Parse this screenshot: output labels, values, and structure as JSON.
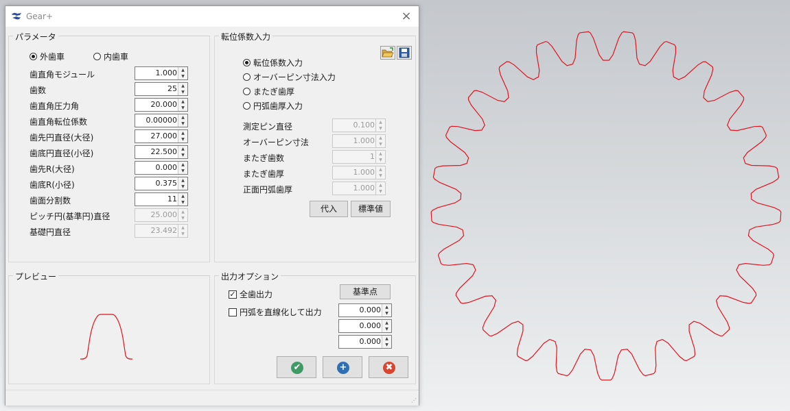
{
  "window": {
    "title": "Gear+",
    "close_glyph": "×"
  },
  "params": {
    "group_label": "パラメータ",
    "external_gear": "外歯車",
    "internal_gear": "内歯車",
    "rows": [
      {
        "label": "歯直角モジュール",
        "value": "1.000",
        "enabled": true
      },
      {
        "label": "歯数",
        "value": "25",
        "enabled": true
      },
      {
        "label": "歯直角圧力角",
        "value": "20.000",
        "enabled": true
      },
      {
        "label": "歯直角転位係数",
        "value": "0.00000",
        "enabled": true
      },
      {
        "label": "歯先円直径(大径)",
        "value": "27.000",
        "enabled": true
      },
      {
        "label": "歯底円直径(小径)",
        "value": "22.500",
        "enabled": true
      },
      {
        "label": "歯先R(大径)",
        "value": "0.000",
        "enabled": true
      },
      {
        "label": "歯底R(小径)",
        "value": "0.375",
        "enabled": true
      },
      {
        "label": "歯面分割数",
        "value": "11",
        "enabled": true
      },
      {
        "label": "ピッチ円(基準円)直径",
        "value": "25.000",
        "enabled": false
      },
      {
        "label": "基礎円直径",
        "value": "23.492",
        "enabled": false
      }
    ]
  },
  "shift": {
    "group_label": "転位係数入力",
    "options": [
      "転位係数入力",
      "オーバーピン寸法入力",
      "またぎ歯厚",
      "円弧歯厚入力"
    ],
    "selected_index": 0,
    "rows": [
      {
        "label": "測定ピン直径",
        "value": "0.100"
      },
      {
        "label": "オーバーピン寸法",
        "value": "1.000"
      },
      {
        "label": "またぎ歯数",
        "value": "1"
      },
      {
        "label": "またぎ歯厚",
        "value": "1.000"
      },
      {
        "label": "正面円弧歯厚",
        "value": "1.000"
      }
    ],
    "substitute_button": "代入",
    "standard_button": "標準値",
    "open_icon": "folder-open-icon",
    "save_icon": "save-disk-icon"
  },
  "preview": {
    "group_label": "プレビュー"
  },
  "output": {
    "group_label": "出力オプション",
    "all_teeth_label": "全歯出力",
    "all_teeth_checked": true,
    "linearize_label": "円弧を直線化して出力",
    "linearize_checked": false,
    "base_point_button": "基準点",
    "coords": [
      "0.000",
      "0.000",
      "0.000"
    ]
  },
  "actions": {
    "ok_icon": "check-circle-icon",
    "add_icon": "plus-circle-icon",
    "cancel_icon": "x-circle-icon",
    "ok_color": "#3f9a66",
    "add_color": "#2f6fb3",
    "cancel_color": "#d9452f",
    "ok_glyph": "✔",
    "add_glyph": "+",
    "cancel_glyph": "✖"
  },
  "gear_render": {
    "teeth": 25,
    "stroke_color": "#e0141e"
  }
}
